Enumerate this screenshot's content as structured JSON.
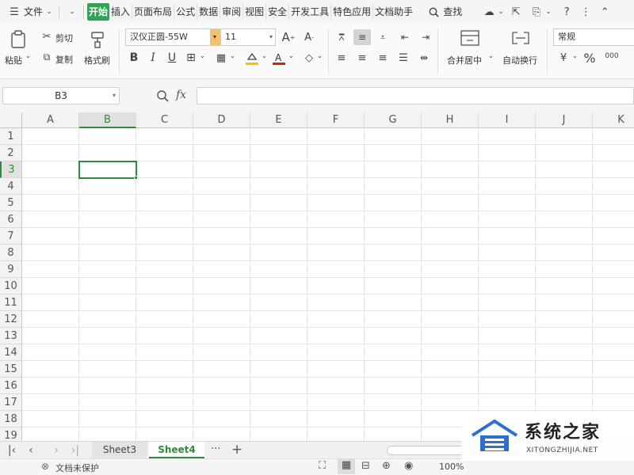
{
  "menubar": {
    "file_label": "文件",
    "tabs": [
      "开始",
      "插入",
      "页面布局",
      "公式",
      "数据",
      "审阅",
      "视图",
      "安全",
      "开发工具",
      "特色应用",
      "文档助手"
    ],
    "active_tab": "开始",
    "search_label": "查找"
  },
  "ribbon": {
    "paste_label": "粘贴",
    "cut_label": "剪切",
    "copy_label": "复制",
    "format_painter_label": "格式刷",
    "font_name": "汉仪正圆-55W",
    "font_size": "11",
    "merge_center_label": "合并居中",
    "wrap_text_label": "自动换行",
    "number_format": "常规"
  },
  "formula_bar": {
    "name_box": "B3",
    "fx_label": "fx",
    "formula_value": ""
  },
  "grid": {
    "columns": [
      "A",
      "B",
      "C",
      "D",
      "E",
      "F",
      "G",
      "H",
      "I",
      "J",
      "K"
    ],
    "rows": [
      "1",
      "2",
      "3",
      "4",
      "5",
      "6",
      "7",
      "8",
      "9",
      "10",
      "11",
      "12",
      "13",
      "14",
      "15",
      "16",
      "17",
      "18",
      "19"
    ],
    "selected_column": "B",
    "selected_row": "3",
    "active_cell": "B3"
  },
  "sheets": {
    "tabs": [
      "Sheet3",
      "Sheet4"
    ],
    "active": "Sheet4",
    "more_label": "···",
    "add_label": "+"
  },
  "statusbar": {
    "protect_label": "文档未保护",
    "zoom": "100%"
  },
  "watermark": {
    "title": "系统之家",
    "subtitle": "XITONGZHIJIA.NET"
  },
  "colors": {
    "accent": "#31a354",
    "selection": "#2f8b3c"
  }
}
